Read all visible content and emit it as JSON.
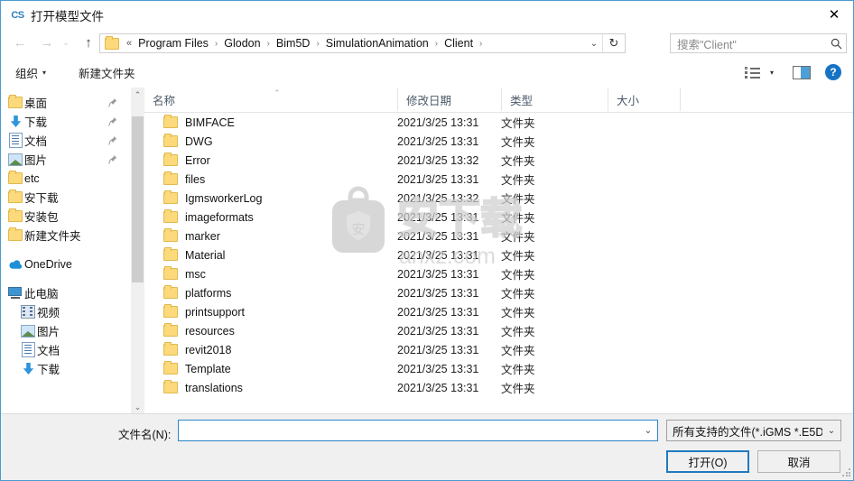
{
  "window": {
    "app_icon_text": "CS",
    "title": "打开模型文件",
    "close_label": "✕"
  },
  "nav": {
    "back_icon": "←",
    "forward_icon": "→",
    "recent_icon": "⌄",
    "up_icon": "↑",
    "overflow": "«",
    "breadcrumbs": [
      "Program Files",
      "Glodon",
      "Bim5D",
      "SimulationAnimation",
      "Client"
    ],
    "separator": "›",
    "dropdown_icon": "⌄",
    "refresh_icon": "↻"
  },
  "search": {
    "placeholder": "搜索\"Client\"",
    "icon": "search-icon"
  },
  "toolbar": {
    "organize_label": "组织",
    "organize_caret": "▾",
    "new_folder_label": "新建文件夹",
    "views_caret": "▾",
    "help_label": "?"
  },
  "sidebar": {
    "quick_items": [
      {
        "label": "桌面",
        "icon": "folder-icon",
        "pinned": true
      },
      {
        "label": "下载",
        "icon": "download-icon",
        "pinned": true
      },
      {
        "label": "文档",
        "icon": "document-icon",
        "pinned": true
      },
      {
        "label": "图片",
        "icon": "picture-icon",
        "pinned": true
      },
      {
        "label": "etc",
        "icon": "folder-icon",
        "pinned": false
      },
      {
        "label": "安下载",
        "icon": "folder-icon",
        "pinned": false
      },
      {
        "label": "安装包",
        "icon": "folder-icon",
        "pinned": false
      },
      {
        "label": "新建文件夹",
        "icon": "folder-icon",
        "pinned": false
      }
    ],
    "onedrive": {
      "label": "OneDrive",
      "icon": "onedrive-icon"
    },
    "thispc": {
      "label": "此电脑",
      "icon": "computer-icon"
    },
    "pc_children": [
      {
        "label": "视频",
        "icon": "video-icon"
      },
      {
        "label": "图片",
        "icon": "picture-icon"
      },
      {
        "label": "文档",
        "icon": "document-icon"
      },
      {
        "label": "下载",
        "icon": "download-icon"
      }
    ],
    "scroll_up_icon": "⌃",
    "scroll_down_icon": "⌄"
  },
  "filelist": {
    "columns": {
      "name": "名称",
      "date": "修改日期",
      "type": "类型",
      "size": "大小"
    },
    "sort_indicator": "⌃",
    "rows": [
      {
        "name": "BIMFACE",
        "date": "2021/3/25 13:31",
        "type": "文件夹",
        "size": ""
      },
      {
        "name": "DWG",
        "date": "2021/3/25 13:31",
        "type": "文件夹",
        "size": ""
      },
      {
        "name": "Error",
        "date": "2021/3/25 13:32",
        "type": "文件夹",
        "size": ""
      },
      {
        "name": "files",
        "date": "2021/3/25 13:31",
        "type": "文件夹",
        "size": ""
      },
      {
        "name": "IgmsworkerLog",
        "date": "2021/3/25 13:32",
        "type": "文件夹",
        "size": ""
      },
      {
        "name": "imageformats",
        "date": "2021/3/25 13:31",
        "type": "文件夹",
        "size": ""
      },
      {
        "name": "marker",
        "date": "2021/3/25 13:31",
        "type": "文件夹",
        "size": ""
      },
      {
        "name": "Material",
        "date": "2021/3/25 13:31",
        "type": "文件夹",
        "size": ""
      },
      {
        "name": "msc",
        "date": "2021/3/25 13:31",
        "type": "文件夹",
        "size": ""
      },
      {
        "name": "platforms",
        "date": "2021/3/25 13:31",
        "type": "文件夹",
        "size": ""
      },
      {
        "name": "printsupport",
        "date": "2021/3/25 13:31",
        "type": "文件夹",
        "size": ""
      },
      {
        "name": "resources",
        "date": "2021/3/25 13:31",
        "type": "文件夹",
        "size": ""
      },
      {
        "name": "revit2018",
        "date": "2021/3/25 13:31",
        "type": "文件夹",
        "size": ""
      },
      {
        "name": "Template",
        "date": "2021/3/25 13:31",
        "type": "文件夹",
        "size": ""
      },
      {
        "name": "translations",
        "date": "2021/3/25 13:31",
        "type": "文件夹",
        "size": ""
      }
    ]
  },
  "watermark": {
    "shield_char": "安",
    "text": "安下载",
    "url": "anxz.com"
  },
  "bottom": {
    "filename_label": "文件名(N):",
    "filename_value": "",
    "filename_caret": "⌄",
    "filter_value": "所有支持的文件(*.iGMS *.E5D",
    "filter_caret": "⌄",
    "open_label": "打开(O)",
    "cancel_label": "取消"
  },
  "colors": {
    "accent": "#1f7bbf",
    "window_border": "#4a9bd1",
    "folder_fill": "#fcd97a",
    "bottom_bg": "#f0f0f0"
  }
}
